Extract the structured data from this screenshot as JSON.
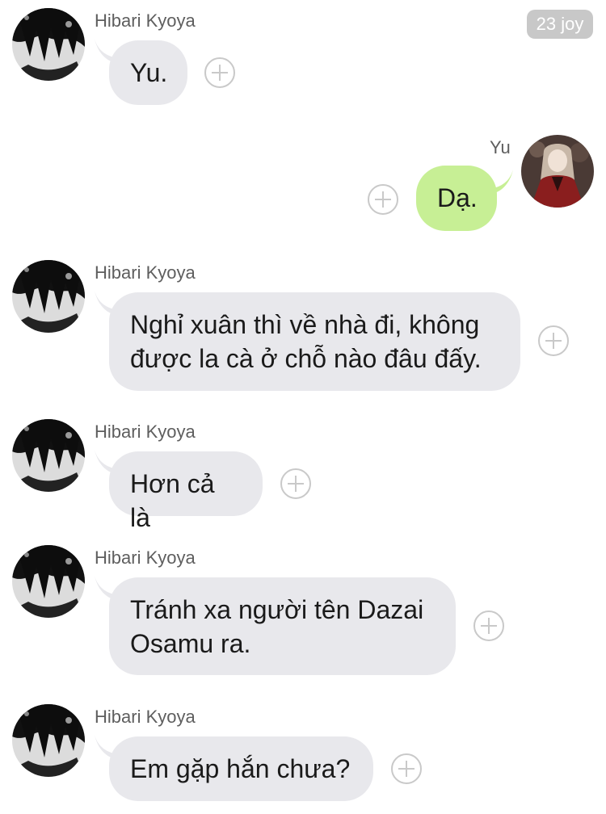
{
  "badge": {
    "label": "23 joy"
  },
  "messages": [
    {
      "sender": "Hibari Kyoya",
      "text": "Yu.",
      "direction": "incoming"
    },
    {
      "sender": "Yu",
      "text": "Dạ.",
      "direction": "outgoing"
    },
    {
      "sender": "Hibari Kyoya",
      "text": "Nghỉ xuân thì về nhà đi, không\nđược la cà ở chỗ nào đâu đấy.",
      "direction": "incoming"
    },
    {
      "sender": "Hibari Kyoya",
      "text": "Hơn cả là",
      "direction": "incoming"
    },
    {
      "sender": "Hibari Kyoya",
      "text": "Tránh xa người tên Dazai\nOsamu ra.",
      "direction": "incoming"
    },
    {
      "sender": "Hibari Kyoya",
      "text": "Em gặp hắn chưa?",
      "direction": "incoming"
    }
  ],
  "colors": {
    "incoming_bubble": "#e8e8ec",
    "outgoing_bubble": "#c7ef95",
    "badge_bg": "#c8c8c8"
  },
  "icons": {
    "reaction": "plus-circle-icon",
    "incoming_avatar": "dark-haired-character-avatar",
    "outgoing_avatar": "red-dress-character-avatar"
  }
}
